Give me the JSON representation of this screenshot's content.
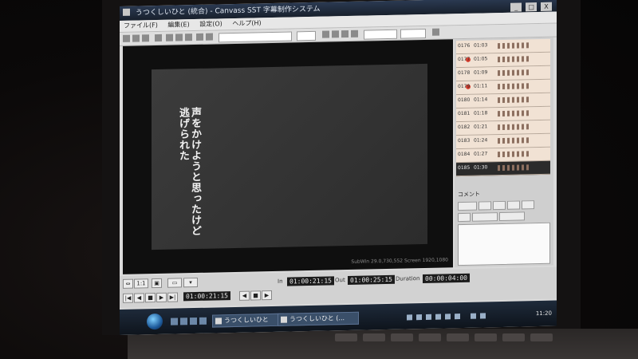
{
  "window": {
    "title": "うつくしいひと (統合) - Canvass SST 字幕制作システム",
    "controls": [
      "_",
      "□",
      "X"
    ]
  },
  "menu": [
    "ファイル(F)",
    "編集(E)",
    "設定(O)",
    "ヘルプ(H)"
  ],
  "video": {
    "subtitle_line1": "声をかけようと思ったけど",
    "subtitle_line2": "逃げられた",
    "status_text": "SubWin 29.0,730,552 Screen 1920,1080"
  },
  "subtitle_list": {
    "rows": [
      {
        "num": "0176",
        "tc": "01:03"
      },
      {
        "num": "0177",
        "tc": "01:05"
      },
      {
        "num": "0178",
        "tc": "01:09"
      },
      {
        "num": "0179",
        "tc": "01:11"
      },
      {
        "num": "0180",
        "tc": "01:14"
      },
      {
        "num": "0181",
        "tc": "01:18"
      },
      {
        "num": "0182",
        "tc": "01:21"
      },
      {
        "num": "0183",
        "tc": "01:24"
      },
      {
        "num": "0184",
        "tc": "01:27"
      },
      {
        "num": "0185",
        "tc": "01:30"
      }
    ],
    "comment_label": "コメント"
  },
  "transport": {
    "current_tc": "01:00:21:15",
    "in_label": "In",
    "in_tc": "01:00:21:15",
    "out_label": "Out",
    "out_tc": "01:00:25:15",
    "duration_label": "Duration",
    "duration_tc": "00:00:04:00"
  },
  "taskbar": {
    "buttons": [
      "うつくしいひと",
      "うつくしいひと (..."
    ],
    "clock": "11:20"
  }
}
